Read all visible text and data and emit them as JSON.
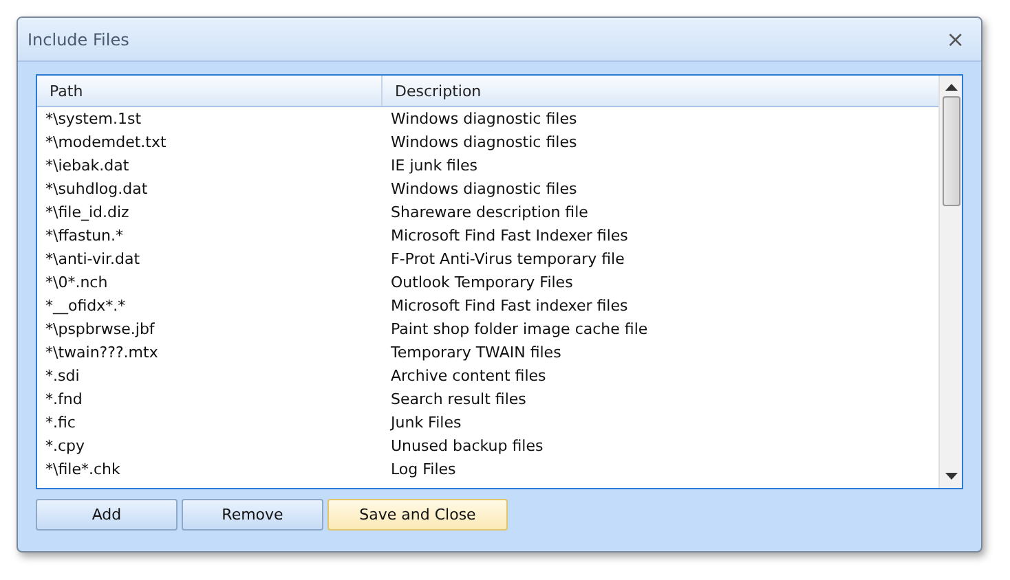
{
  "window": {
    "title": "Include Files",
    "close": "×"
  },
  "table": {
    "columns": [
      "Path",
      "Description"
    ],
    "rows": [
      {
        "path": "*\\system.1st",
        "description": "Windows diagnostic files"
      },
      {
        "path": "*\\modemdet.txt",
        "description": "Windows diagnostic files"
      },
      {
        "path": "*\\iebak.dat",
        "description": "IE junk files"
      },
      {
        "path": "*\\suhdlog.dat",
        "description": "Windows diagnostic files"
      },
      {
        "path": "*\\file_id.diz",
        "description": "Shareware description file"
      },
      {
        "path": "*\\ffastun.*",
        "description": "Microsoft Find Fast Indexer files"
      },
      {
        "path": "*\\anti-vir.dat",
        "description": "F-Prot Anti-Virus temporary file"
      },
      {
        "path": "*\\0*.nch",
        "description": "Outlook Temporary Files"
      },
      {
        "path": "*__ofidx*.*",
        "description": "Microsoft Find Fast indexer files"
      },
      {
        "path": "*\\pspbrwse.jbf",
        "description": "Paint shop folder image cache file"
      },
      {
        "path": "*\\twain???.mtx",
        "description": "Temporary TWAIN files"
      },
      {
        "path": "*.sdi",
        "description": "Archive content files"
      },
      {
        "path": "*.fnd",
        "description": "Search result files"
      },
      {
        "path": "*.fic",
        "description": "Junk Files"
      },
      {
        "path": "*.cpy",
        "description": "Unused backup files"
      },
      {
        "path": "*\\file*.chk",
        "description": "Log Files"
      }
    ]
  },
  "buttons": [
    {
      "label": "Add",
      "focused": false
    },
    {
      "label": "Remove",
      "focused": false
    },
    {
      "label": "Save and Close",
      "focused": true
    }
  ]
}
